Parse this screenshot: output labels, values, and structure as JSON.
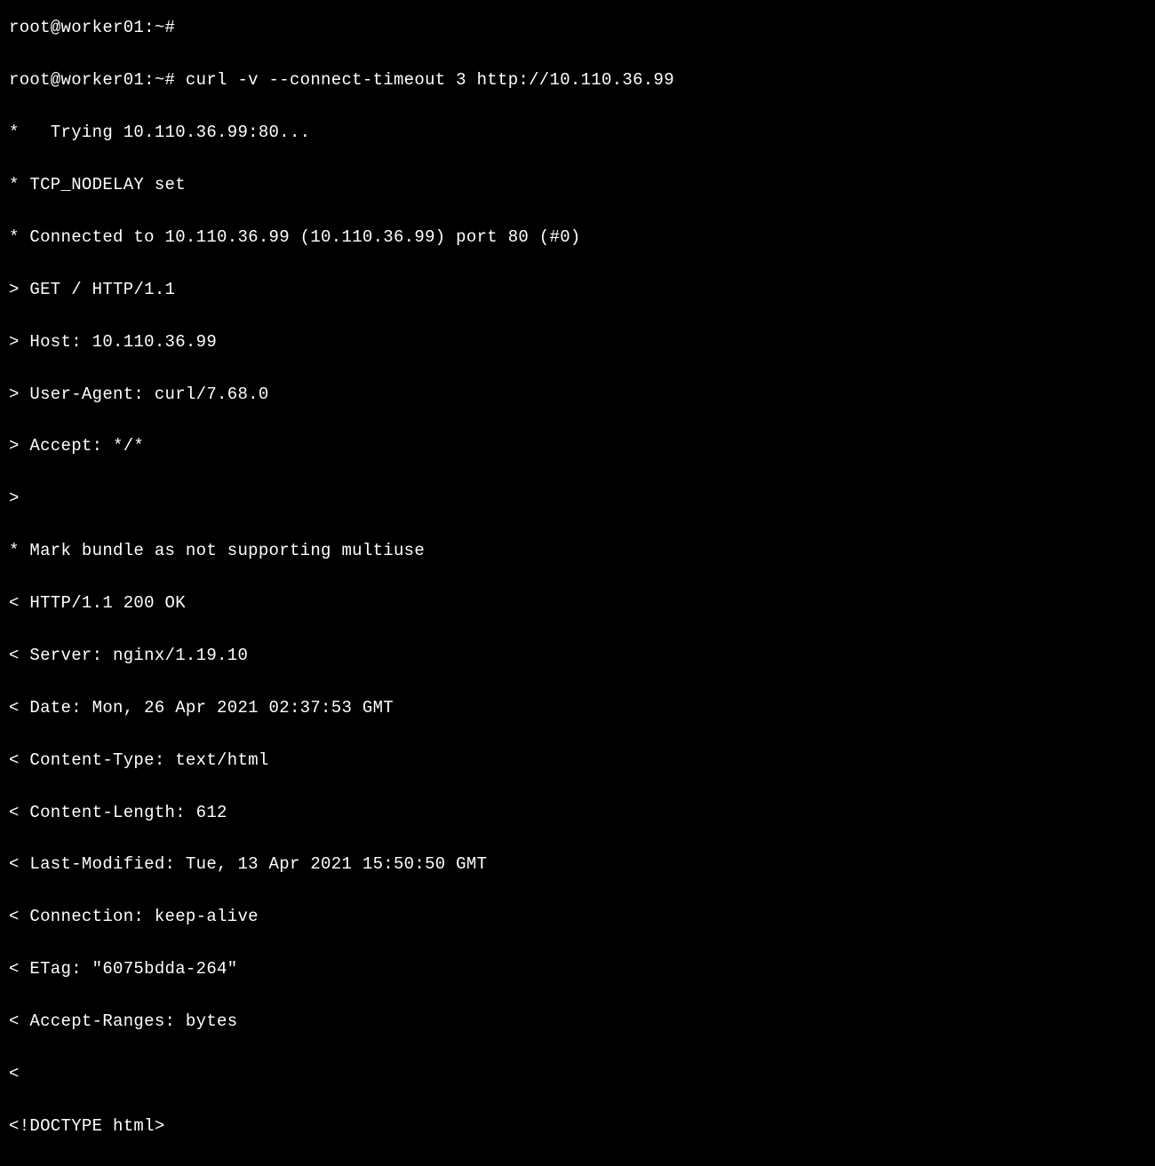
{
  "terminal": {
    "lines": [
      "root@worker01:~#",
      "root@worker01:~# curl -v --connect-timeout 3 http://10.110.36.99",
      "*   Trying 10.110.36.99:80...",
      "* TCP_NODELAY set",
      "* Connected to 10.110.36.99 (10.110.36.99) port 80 (#0)",
      "> GET / HTTP/1.1",
      "> Host: 10.110.36.99",
      "> User-Agent: curl/7.68.0",
      "> Accept: */*",
      ">",
      "* Mark bundle as not supporting multiuse",
      "< HTTP/1.1 200 OK",
      "< Server: nginx/1.19.10",
      "< Date: Mon, 26 Apr 2021 02:37:53 GMT",
      "< Content-Type: text/html",
      "< Content-Length: 612",
      "< Last-Modified: Tue, 13 Apr 2021 15:50:50 GMT",
      "< Connection: keep-alive",
      "< ETag: \"6075bdda-264\"",
      "< Accept-Ranges: bytes",
      "<",
      "<!DOCTYPE html>"
    ]
  }
}
